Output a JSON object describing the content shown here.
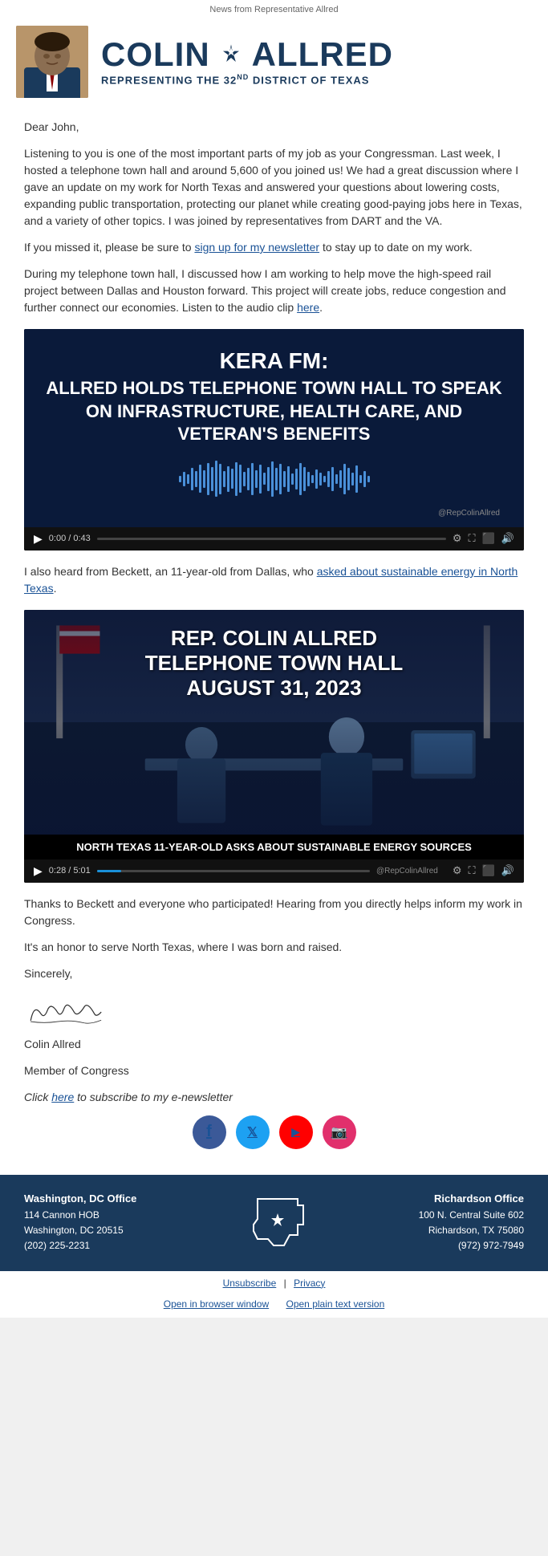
{
  "topbar": {
    "text": "News from Representative Allred"
  },
  "header": {
    "name_part1": "COLIN",
    "name_part2": "ALLRED",
    "subtitle": "REPRESENTING THE 32",
    "subtitle_sup": "ND",
    "subtitle_end": " DISTRICT OF TEXAS"
  },
  "email": {
    "greeting": "Dear John,",
    "paragraph1": "Listening to you is one of the most important parts of my job as your Congressman. Last week, I hosted a telephone town hall and around 5,600 of you joined us! We had a great discussion where I gave an update on my work for North Texas and answered your questions about lowering costs, expanding public transportation, protecting our planet while creating good-paying jobs here in Texas, and a variety of other topics. I was joined by representatives from DART and the VA.",
    "paragraph2": "If you missed it, please be sure to",
    "link1_text": "sign up for my newsletter",
    "paragraph2_end": "to stay up to date on my work.",
    "paragraph3": "During my telephone town hall, I discussed how I am working to help move the high-speed rail project between Dallas and Houston forward. This project will create jobs, reduce congestion and further connect our economies. Listen to the audio clip",
    "link2_text": "here",
    "paragraph3_end": ".",
    "paragraph4_pre": "I also heard from Beckett, an 11-year-old from Dallas, who",
    "link3_text": "asked about sustainable energy in North Texas",
    "paragraph4_end": ".",
    "paragraph5": "Thanks to Beckett and everyone who participated! Hearing from you directly helps inform my work in Congress.",
    "paragraph6": "It's an honor to serve North Texas, where I was born and raised.",
    "sincerely": "Sincerely,",
    "name": "Colin Allred",
    "title": "Member of Congress",
    "newsletter_pre": "Click",
    "newsletter_link": "here",
    "newsletter_post": "to subscribe to my e-newsletter"
  },
  "video1": {
    "kera_label": "KERA FM:",
    "title": "ALLRED HOLDS TELEPHONE TOWN HALL TO SPEAK ON INFRASTRUCTURE, HEALTH CARE, AND VETERAN'S BENEFITS",
    "time": "0:00 / 0:43",
    "watermark": "@RepColinAllred"
  },
  "video2": {
    "title": "REP. COLIN ALLRED",
    "title2": "TELEPHONE TOWN HALL",
    "title3": "AUGUST 31, 2023",
    "caption": "NORTH TEXAS 11-YEAR-OLD ASKS ABOUT SUSTAINABLE ENERGY SOURCES",
    "time": "0:28 / 5:01",
    "watermark": "@RepColinAllred"
  },
  "footer": {
    "washington_office_label": "Washington, DC Office",
    "washington_address1": "114 Cannon HOB",
    "washington_address2": "Washington, DC 20515",
    "washington_phone": "(202) 225-2231",
    "richardson_office_label": "Richardson Office",
    "richardson_address1": "100 N. Central Suite 602",
    "richardson_address2": "Richardson, TX 75080",
    "richardson_phone": "(972) 972-7949"
  },
  "social": {
    "facebook_label": "f",
    "twitter_label": "t",
    "youtube_label": "▶",
    "instagram_label": "📷"
  },
  "bottomLinks": {
    "unsubscribe": "Unsubscribe",
    "privacy": "Privacy",
    "browser": "Open in browser window",
    "plain": "Open plain text version"
  }
}
